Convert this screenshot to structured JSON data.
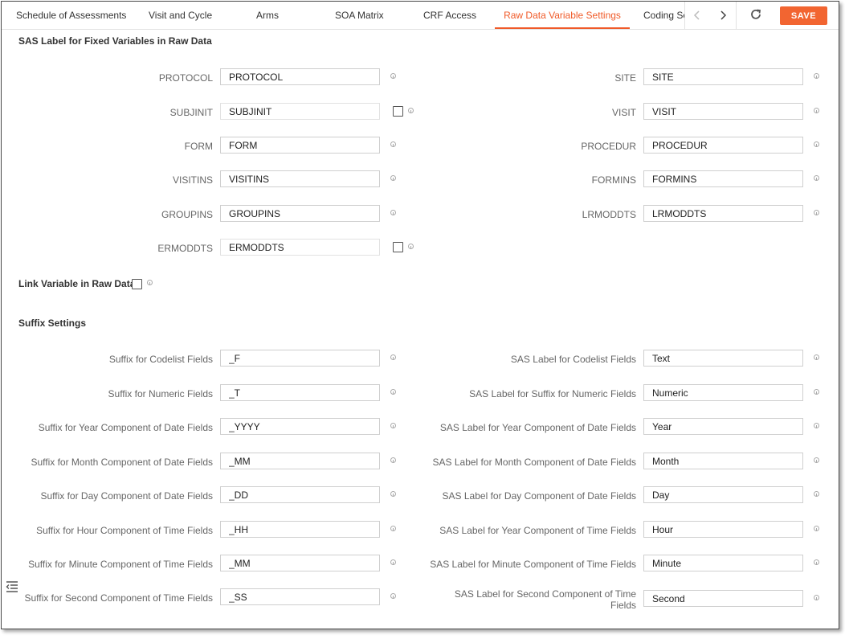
{
  "tabs": [
    {
      "label": "Schedule of Assessments"
    },
    {
      "label": "Visit and Cycle"
    },
    {
      "label": "Arms"
    },
    {
      "label": "SOA Matrix"
    },
    {
      "label": "CRF Access"
    },
    {
      "label": "Raw Data Variable Settings"
    },
    {
      "label": "Coding Set"
    }
  ],
  "active_tab": "Raw Data Variable Settings",
  "toolbar": {
    "save_label": "SAVE",
    "icons": [
      "chevron-left-icon",
      "chevron-right-icon",
      "refresh-icon"
    ]
  },
  "fixed_section": {
    "title": "SAS Label for Fixed Variables in Raw Data",
    "fields": {
      "protocol": {
        "label": "PROTOCOL",
        "value": "PROTOCOL"
      },
      "site": {
        "label": "SITE",
        "value": "SITE"
      },
      "subjinit": {
        "label": "SUBJINIT",
        "value": "SUBJINIT"
      },
      "visit": {
        "label": "VISIT",
        "value": "VISIT"
      },
      "form": {
        "label": "FORM",
        "value": "FORM"
      },
      "procedur": {
        "label": "PROCEDUR",
        "value": "PROCEDUR"
      },
      "visitins": {
        "label": "VISITINS",
        "value": "VISITINS"
      },
      "formins": {
        "label": "FORMINS",
        "value": "FORMINS"
      },
      "groupins": {
        "label": "GROUPINS",
        "value": "GROUPINS"
      },
      "lrmoddts": {
        "label": "LRMODDTS",
        "value": "LRMODDTS"
      },
      "ermoddts": {
        "label": "ERMODDTS",
        "value": "ERMODDTS"
      }
    }
  },
  "link_variable": {
    "label": "Link Variable in Raw Data"
  },
  "suffix_section": {
    "title": "Suffix Settings",
    "left": [
      {
        "label": "Suffix for Codelist Fields",
        "value": "_F"
      },
      {
        "label": "Suffix for Numeric Fields",
        "value": "_T"
      },
      {
        "label": "Suffix for Year Component of Date Fields",
        "value": "_YYYY"
      },
      {
        "label": "Suffix for Month Component of Date Fields",
        "value": "_MM"
      },
      {
        "label": "Suffix for Day Component of Date Fields",
        "value": "_DD"
      },
      {
        "label": "Suffix for Hour Component of Time Fields",
        "value": "_HH"
      },
      {
        "label": "Suffix for Minute Component of Time Fields",
        "value": "_MM"
      },
      {
        "label": "Suffix for Second Component of Time Fields",
        "value": "_SS"
      }
    ],
    "right": [
      {
        "label": "SAS Label for Codelist Fields",
        "value": "Text"
      },
      {
        "label": "SAS Label for Suffix for Numeric Fields",
        "value": "Numeric"
      },
      {
        "label": "SAS Label for Year Component of Date Fields",
        "value": "Year"
      },
      {
        "label": "SAS Label for Month Component of Date Fields",
        "value": "Month"
      },
      {
        "label": "SAS Label for Day Component of Date Fields",
        "value": "Day"
      },
      {
        "label": "SAS Label for Year Component of Time Fields",
        "value": "Hour"
      },
      {
        "label": "SAS Label for Minute Component of Time Fields",
        "value": "Minute"
      },
      {
        "label": "SAS Label for Second Component of Time Fields",
        "value": "Second"
      }
    ]
  },
  "colors": {
    "accent": "#f05a28",
    "save_button": "#f26531"
  }
}
